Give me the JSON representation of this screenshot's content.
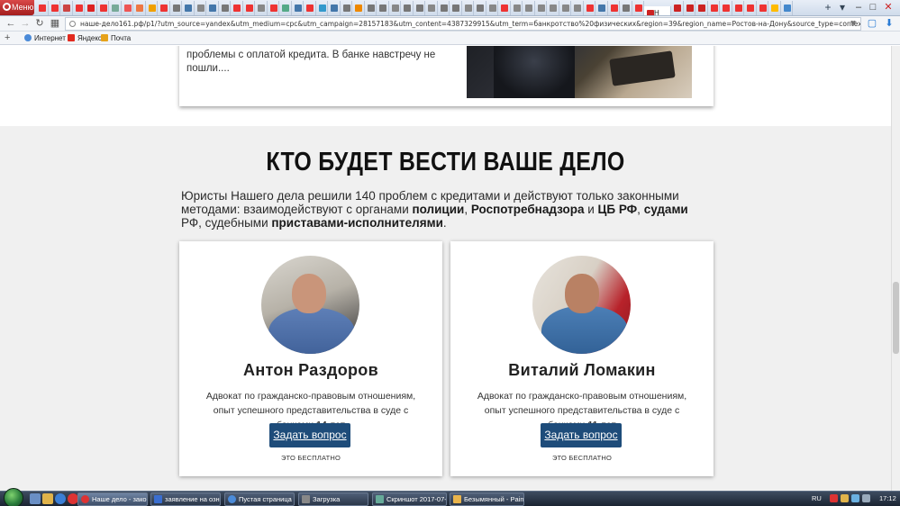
{
  "browser": {
    "menu_label": "Меню",
    "active_tab_title": "Н",
    "url": "наше-дело161.рф/p1/?utm_source=yandex&utm_medium=cpc&utm_campaign=28157183&utm_content=4387329915&utm_term=банкротство%20физических&region=39&region_name=Ростов-на-Дону&source_type=context&source=news.yandex.ru",
    "bookmarks": [
      {
        "label": "Интернет",
        "color": "#4a8ad8"
      },
      {
        "label": "Яндекс",
        "color": "#e22a1f"
      },
      {
        "label": "Почта",
        "color": "#e6a21a"
      }
    ],
    "tab_colors": [
      "#e33",
      "#e33",
      "#c44",
      "#e33",
      "#d22",
      "#e33",
      "#7a9",
      "#e55",
      "#e74",
      "#f0a000",
      "#e33",
      "#777",
      "#47a",
      "#888",
      "#47a",
      "#777",
      "#e33",
      "#e33",
      "#888",
      "#e33",
      "#5a8",
      "#47a",
      "#e33",
      "#39c",
      "#47a",
      "#777",
      "#e80",
      "#777",
      "#777",
      "#888",
      "#777",
      "#777",
      "#888",
      "#777",
      "#777",
      "#888",
      "#777",
      "#888",
      "#e33",
      "#888",
      "#888",
      "#888",
      "#888",
      "#888",
      "#888",
      "#e33",
      "#47a",
      "#e33",
      "#777",
      "#e33",
      "#c22",
      "#c22",
      "#c22",
      "#e33",
      "#e33",
      "#e33",
      "#e33",
      "#e33",
      "#fb0",
      "#48c"
    ]
  },
  "page": {
    "previous_card_text": "проблемы с оплатой кредита. В банке навстречу не пошли....",
    "section_title": "КТО БУДЕТ ВЕСТИ ВАШЕ ДЕЛО",
    "lead": {
      "p1": "Юристы Нашего дела решили 140 проблем с кредитами и действуют только законными методами: взаимодействуют с органами ",
      "b1": "полиции",
      "p2": ", ",
      "b2": "Роспотребнадзора",
      "p3": " и ",
      "b3": "ЦБ РФ",
      "p4": ", ",
      "b4": "судами",
      "p5": " РФ, судебными ",
      "b5": "приставами-исполнителями",
      "p6": "."
    },
    "lawyers": [
      {
        "name": "Антон Раздоров",
        "description": "Адвокат по гражданско-правовым отношениям, опыт успешного представительства в суде с банками",
        "experience": "14 лет",
        "button_label": "Задать вопрос",
        "free_label": "ЭТО БЕСПЛАТНО"
      },
      {
        "name": "Виталий Ломакин",
        "description": "Адвокат по гражданско-правовым отношениям, опыт успешного представительства в суде с банками",
        "experience": "11 лет",
        "button_label": "Задать вопрос",
        "free_label": "ЭТО БЕСПЛАТНО"
      }
    ]
  },
  "taskbar": {
    "items": [
      {
        "label": "Наше дело - закон...",
        "color": "#d33",
        "active": true
      },
      {
        "label": "заявление на ознак...",
        "color": "#3a6ed0",
        "active": false
      },
      {
        "label": "Пустая страница - ...",
        "color": "#4b8bd9",
        "active": false
      },
      {
        "label": "Загрузка",
        "color": "#888",
        "active": false
      },
      {
        "label": "Скриншот 2017-07-...",
        "color": "#6a9",
        "active": false
      },
      {
        "label": "Безымянный - Paint",
        "color": "#e9b44c",
        "active": false
      }
    ],
    "language": "RU",
    "clock": "17:12"
  },
  "colors": {
    "accent_button": "#1e4c7a",
    "section_bg": "#f0f0f0"
  }
}
